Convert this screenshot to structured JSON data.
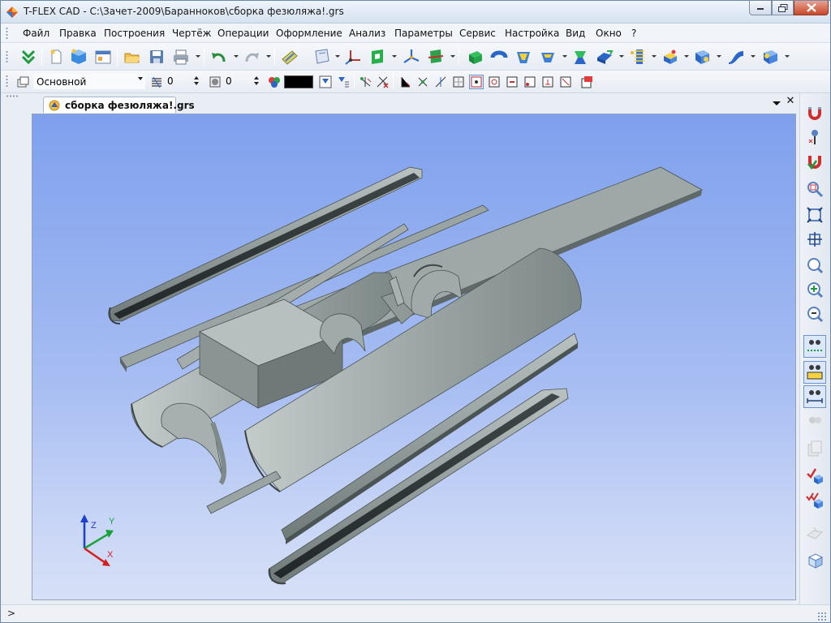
{
  "window": {
    "title": "T-FLEX CAD - C:\\Зачет-2009\\Баранноков\\сборка фезюляжа!.grs"
  },
  "menu": [
    "Файл",
    "Правка",
    "Построения",
    "Чертёж",
    "Операции",
    "Оформление",
    "Анализ",
    "Параметры",
    "Сервис",
    "Настройка",
    "Вид",
    "Окно",
    "?"
  ],
  "toolbar1": {
    "icons": [
      "double-chevron-icon",
      "new-document-icon",
      "new-3d-model-icon",
      "new-window-icon",
      "open-folder-icon",
      "save-icon",
      "print-icon",
      "undo-icon",
      "redo-icon",
      "edit-element-icon",
      "workplane-icon",
      "coordinate-system-icon",
      "profile-icon",
      "lcs-icon",
      "section-icon",
      "extrude-icon",
      "rotate-icon",
      "loft-icon",
      "shell-icon",
      "boolean-icon",
      "smooth-icon",
      "spring-icon",
      "array-icon",
      "blend-icon",
      "surface-icon",
      "body-settings-icon"
    ]
  },
  "toolbar2": {
    "layer_value": "Основной",
    "level_value": "0",
    "priority_value": "0",
    "color": "#000000"
  },
  "document": {
    "tab_label": "сборка фезюляжа!.grs"
  },
  "viewport": {
    "axis_labels": {
      "x": "X",
      "y": "Y",
      "z": "Z"
    },
    "background_top": "#7ea0ed",
    "background_bottom": "#d7e0f7",
    "part_color": "#a9b2b1"
  },
  "right_toolbar": {
    "icons": [
      "magnet-snap-icon",
      "pin-icon",
      "magnet-check-icon",
      "zoom-window-icon",
      "zoom-all-icon",
      "zoom-fit-icon",
      "zoom-page-icon",
      "zoom-pan-icon",
      "zoom-previous-icon",
      "view-mode-1-icon",
      "view-mode-2-icon",
      "view-mode-3-icon",
      "view-mode-4-icon",
      "copy-icon",
      "check-body-icon",
      "check-intersection-icon",
      "plane-icon",
      "box-view-icon"
    ]
  },
  "status": {
    "text": ">"
  }
}
